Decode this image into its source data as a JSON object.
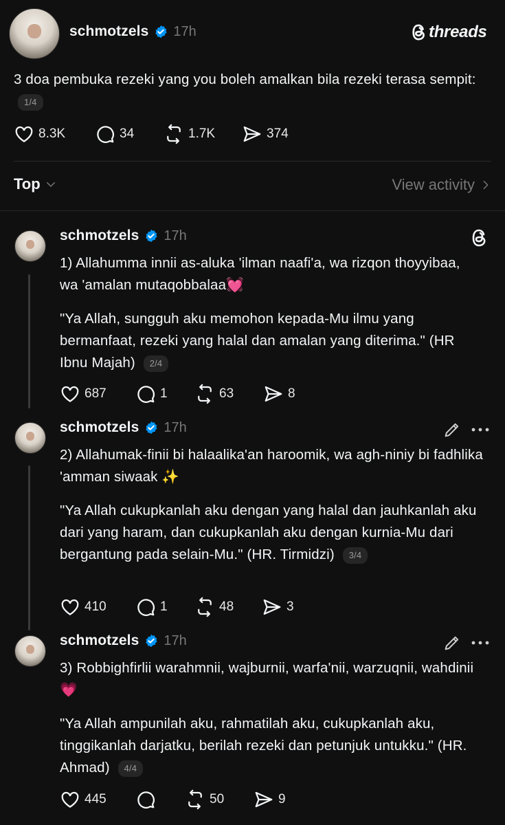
{
  "main_post": {
    "username": "schmotzels",
    "time": "17h",
    "brand": "threads",
    "text": "3 doa pembuka rezeki yang you boleh amalkan bila rezeki terasa sempit:",
    "page": "1/4",
    "likes": "8.3K",
    "replies": "34",
    "reposts": "1.7K",
    "shares": "374"
  },
  "sort": {
    "label": "Top",
    "view_activity": "View activity"
  },
  "replies": [
    {
      "username": "schmotzels",
      "time": "17h",
      "line1": "1) Allahumma innii as-aluka 'ilman naafi'a, wa rizqon thoyyibaa, wa 'amalan mutaqobbalaa💓",
      "line2": "\"Ya Allah, sungguh aku memohon kepada-Mu ilmu yang bermanfaat, rezeki yang halal dan amalan yang diterima.\" (HR Ibnu Majah)",
      "page": "2/4",
      "likes": "687",
      "replies": "1",
      "reposts": "63",
      "shares": "8"
    },
    {
      "username": "schmotzels",
      "time": "17h",
      "line1": "2) Allahumak-finii bi halaalika'an haroomik, wa agh-niniy bi fadhlika 'amman siwaak ✨",
      "line2": "\"Ya Allah cukupkanlah aku dengan yang halal dan jauhkanlah aku dari yang haram, dan cukupkanlah aku dengan kurnia-Mu dari bergantung pada selain-Mu.\" (HR. Tirmidzi)",
      "page": "3/4",
      "likes": "410",
      "replies": "1",
      "reposts": "48",
      "shares": "3"
    },
    {
      "username": "schmotzels",
      "time": "17h",
      "line1": "3) Robbighfirlii warahmnii, wajburnii, warfa'nii, warzuqnii, wahdinii 💗",
      "line2": "\"Ya Allah ampunilah aku, rahmatilah aku, cukupkanlah aku, tinggikanlah darjatku, berilah rezeki dan petunjuk untukku.\" (HR. Ahmad)",
      "page": "4/4",
      "likes": "445",
      "replies": "",
      "reposts": "50",
      "shares": "9"
    }
  ],
  "colors": {
    "background": "#101010",
    "text": "#f3f5f7",
    "muted": "#777777",
    "verified": "#0095f6"
  }
}
